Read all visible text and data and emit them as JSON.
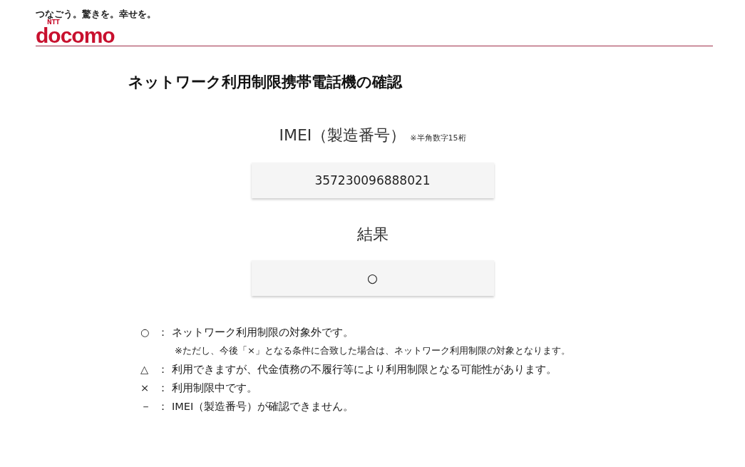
{
  "header": {
    "tagline": "つなごう。驚きを。幸せを。",
    "logo_small": "NTT",
    "logo": "docomo"
  },
  "title": "ネットワーク利用制限携帯電話機の確認",
  "imei": {
    "label": "IMEI（製造番号）",
    "note": "※半角数字15桁",
    "value": "357230096888021"
  },
  "result": {
    "label": "結果",
    "value": "○"
  },
  "legend": [
    {
      "symbol": "○",
      "separator": "：",
      "text": "ネットワーク利用制限の対象外です。",
      "note": "※ただし、今後「×」となる条件に合致した場合は、ネットワーク利用制限の対象となります。"
    },
    {
      "symbol": "△",
      "separator": "：",
      "text": "利用できますが、代金債務の不履行等により利用制限となる可能性があります。"
    },
    {
      "symbol": "×",
      "separator": "：",
      "text": "利用制限中です。"
    },
    {
      "symbol": "－",
      "separator": "：",
      "text": "IMEI（製造番号）が確認できません。"
    }
  ]
}
